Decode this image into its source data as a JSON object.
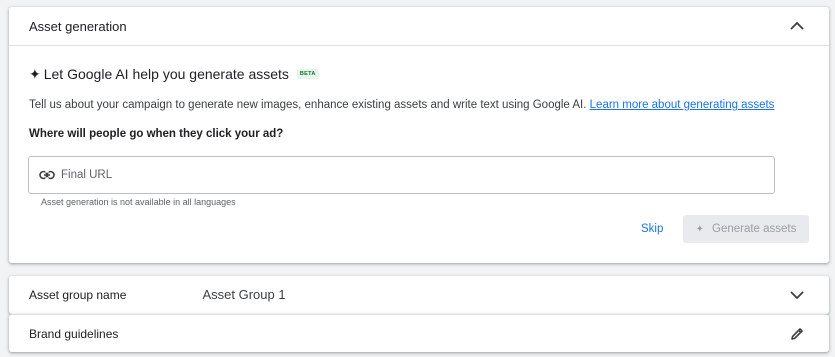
{
  "panel": {
    "title": "Asset generation",
    "ai_title": "Let Google AI help you generate assets",
    "beta": "BETA",
    "description": "Tell us about your campaign to generate new images, enhance existing assets and write text using Google AI.",
    "learn_more": "Learn more about generating assets",
    "question": "Where will people go when they click your ad?",
    "url_placeholder": "Final URL",
    "url_value": "",
    "hint": "Asset generation is not available in all languages",
    "skip_label": "Skip",
    "generate_label": "Generate assets"
  },
  "asset_group": {
    "label": "Asset group name",
    "value": "Asset Group 1"
  },
  "brand": {
    "label": "Brand guidelines"
  },
  "colors": {
    "accent": "#1a73e8",
    "beta_text": "#137333",
    "beta_bg": "#e6f4ea",
    "disabled_bg": "#e8eaed"
  },
  "icons": [
    "chevron-up-icon",
    "sparkle-icon",
    "link-icon",
    "chevron-down-icon",
    "pencil-icon"
  ]
}
